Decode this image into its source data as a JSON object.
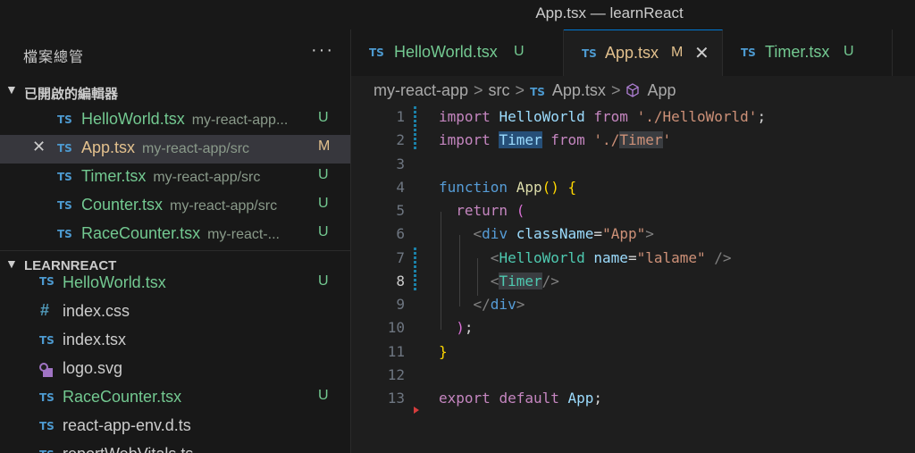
{
  "window": {
    "title": "App.tsx — learnReact"
  },
  "explorer": {
    "title": "檔案總管",
    "more": "···",
    "open_editors": {
      "label": "已開啟的編輯器",
      "items": [
        {
          "name": "HelloWorld.tsx",
          "path": "my-react-app...",
          "badge": "U",
          "status": "untracked"
        },
        {
          "name": "App.tsx",
          "path": "my-react-app/src",
          "badge": "M",
          "status": "modified",
          "close": "✕"
        },
        {
          "name": "Timer.tsx",
          "path": "my-react-app/src",
          "badge": "U",
          "status": "untracked"
        },
        {
          "name": "Counter.tsx",
          "path": "my-react-app/src",
          "badge": "U",
          "status": "untracked"
        },
        {
          "name": "RaceCounter.tsx",
          "path": "my-react-...",
          "badge": "U",
          "status": "untracked"
        }
      ]
    },
    "project": {
      "label": "LEARNREACT",
      "files": [
        {
          "icon": "TS",
          "name": "HelloWorld.tsx",
          "badge": "U"
        },
        {
          "icon": "#",
          "name": "index.css",
          "badge": ""
        },
        {
          "icon": "TS",
          "name": "index.tsx",
          "badge": ""
        },
        {
          "icon": "svg",
          "name": "logo.svg",
          "badge": ""
        },
        {
          "icon": "TS",
          "name": "RaceCounter.tsx",
          "badge": "U"
        },
        {
          "icon": "TS",
          "name": "react-app-env.d.ts",
          "badge": ""
        },
        {
          "icon": "TS",
          "name": "reportWebVitals.ts",
          "badge": ""
        }
      ]
    }
  },
  "tabs": [
    {
      "name": "HelloWorld.tsx",
      "badge": "U",
      "active": false
    },
    {
      "name": "App.tsx",
      "badge": "M",
      "active": true,
      "close": "✕"
    },
    {
      "name": "Timer.tsx",
      "badge": "U",
      "active": false
    }
  ],
  "icon_label": "TS",
  "breadcrumb": {
    "parts": [
      "my-react-app",
      "src",
      "App.tsx",
      "App"
    ],
    "separator": ">"
  },
  "editor": {
    "current_line": 8,
    "line_numbers": [
      "1",
      "2",
      "3",
      "4",
      "5",
      "6",
      "7",
      "8",
      "9",
      "10",
      "11",
      "12",
      "13"
    ],
    "code": {
      "l1": {
        "import": "import",
        "name": "HelloWorld",
        "from": "from",
        "path": "'./HelloWorld'",
        "semi": ";"
      },
      "l2": {
        "import": "import",
        "name": "Timer",
        "from": "from",
        "q1": "'./",
        "path_hl": "Timer",
        "q2": "'"
      },
      "l4": {
        "function": "function",
        "name": "App",
        "paren": "()",
        "brace": "{"
      },
      "l5": {
        "return": "return",
        "paren": "("
      },
      "l6": {
        "open": "<",
        "tag": "div",
        "attr": "className",
        "eq": "=",
        "val": "\"App\"",
        "close": ">"
      },
      "l7": {
        "open": "<",
        "tag": "HelloWorld",
        "attr": "name",
        "eq": "=",
        "val": "\"lalame\"",
        "close": " />"
      },
      "l8": {
        "open": "<",
        "tag": "Timer",
        "close": "/>"
      },
      "l9": {
        "open": "</",
        "tag": "div",
        "close": ">"
      },
      "l10": {
        "paren": ")",
        "semi": ";"
      },
      "l11": {
        "brace": "}"
      },
      "l13": {
        "export": "export",
        "default": "default",
        "name": "App",
        "semi": ";"
      }
    }
  },
  "colors": {
    "background": "#1e1e1e",
    "sidebar": "#181818",
    "untracked": "#73c991",
    "modified": "#e2c08d",
    "ts_icon": "#4d9ad0",
    "accent": "#0078d4"
  }
}
